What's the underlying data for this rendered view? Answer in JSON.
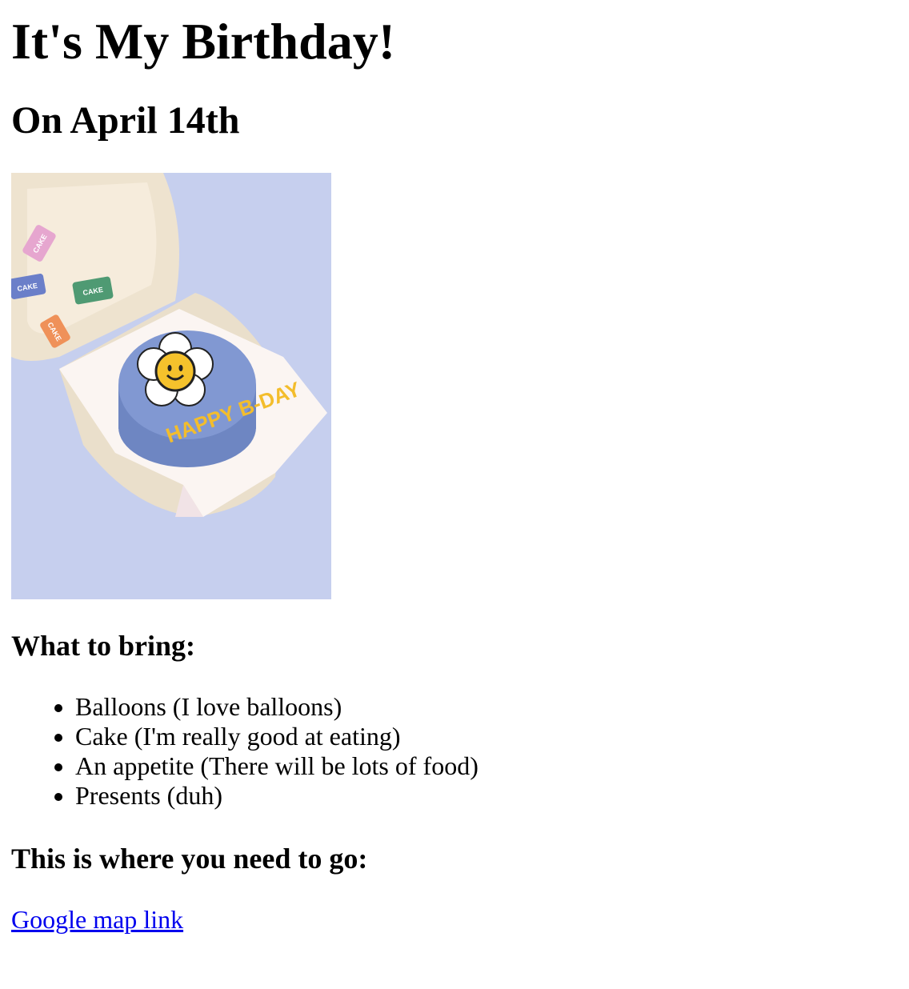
{
  "title": "It's My Birthday!",
  "subtitle": "On April 14th",
  "image": {
    "cake_text": "HAPPY B-DAY",
    "sticker_text": [
      "PIECE OF CAKE",
      "PIECE OF CAKE",
      "PIECE OF CAKE",
      "PIECE OF CAKE"
    ],
    "colors": {
      "background": "#c7d0ee",
      "cake": "#7f97cf",
      "box": "#efe4d2",
      "letters": "#f3bd2c"
    }
  },
  "bring": {
    "heading": "What to bring:",
    "items": [
      "Balloons (I love balloons)",
      "Cake (I'm really good at eating)",
      "An appetite (There will be lots of food)",
      "Presents (duh)"
    ]
  },
  "location": {
    "heading": "This is where you need to go:",
    "link_text": "Google map link"
  },
  "colors": {
    "link": "#0000ee",
    "text": "#000000"
  }
}
